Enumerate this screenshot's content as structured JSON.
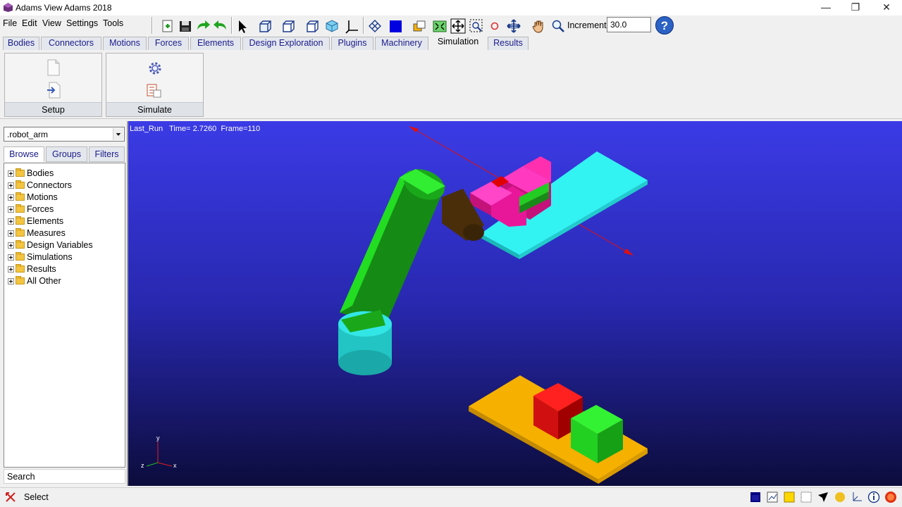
{
  "window": {
    "title": "Adams View Adams 2018",
    "minimize": "—",
    "maximize": "❐",
    "close": "✕"
  },
  "menu": [
    "File",
    "Edit",
    "View",
    "Settings",
    "Tools"
  ],
  "toolbar": {
    "icons": [
      "new-model-icon",
      "save-icon",
      "redo-icon",
      "undo-icon",
      "select-arrow-icon",
      "front-view-icon",
      "side-view-icon",
      "top-view-icon",
      "iso-view-icon",
      "axis-triad-icon",
      "render-mode-icon",
      "shaded-mode-icon",
      "copy-view-icon",
      "zoom-fit-icon",
      "zoom-box-icon",
      "center-icon",
      "rotate-icon",
      "pan-icon",
      "zoom-icon"
    ],
    "increment_label": "Increment",
    "increment_value": "30.0",
    "help": "?"
  },
  "tabs": [
    "Bodies",
    "Connectors",
    "Motions",
    "Forces",
    "Elements",
    "Design Exploration",
    "Plugins",
    "Machinery",
    "Simulation",
    "Results"
  ],
  "active_tab": "Simulation",
  "ribbon": {
    "groups": [
      {
        "label": "Setup"
      },
      {
        "label": "Simulate"
      }
    ]
  },
  "browser": {
    "model": ".robot_arm",
    "tabs": [
      "Browse",
      "Groups",
      "Filters"
    ],
    "tree": [
      "Bodies",
      "Connectors",
      "Motions",
      "Forces",
      "Elements",
      "Measures",
      "Design Variables",
      "Simulations",
      "Results",
      "All Other"
    ],
    "search_placeholder": "Search"
  },
  "viewport": {
    "status": "Last_Run   Time= 2.7260  Frame=110",
    "axis_y": "y",
    "axis_x": "x",
    "axis_z": "z"
  },
  "status_bar": {
    "mode": "Select"
  },
  "colors": {
    "viewport_top": "#3b3be6",
    "viewport_bottom": "#0c0c3c",
    "arm": "#22dd22",
    "base": "#33d4d4",
    "table": "#f5b000",
    "gripper": "#e8179a"
  }
}
